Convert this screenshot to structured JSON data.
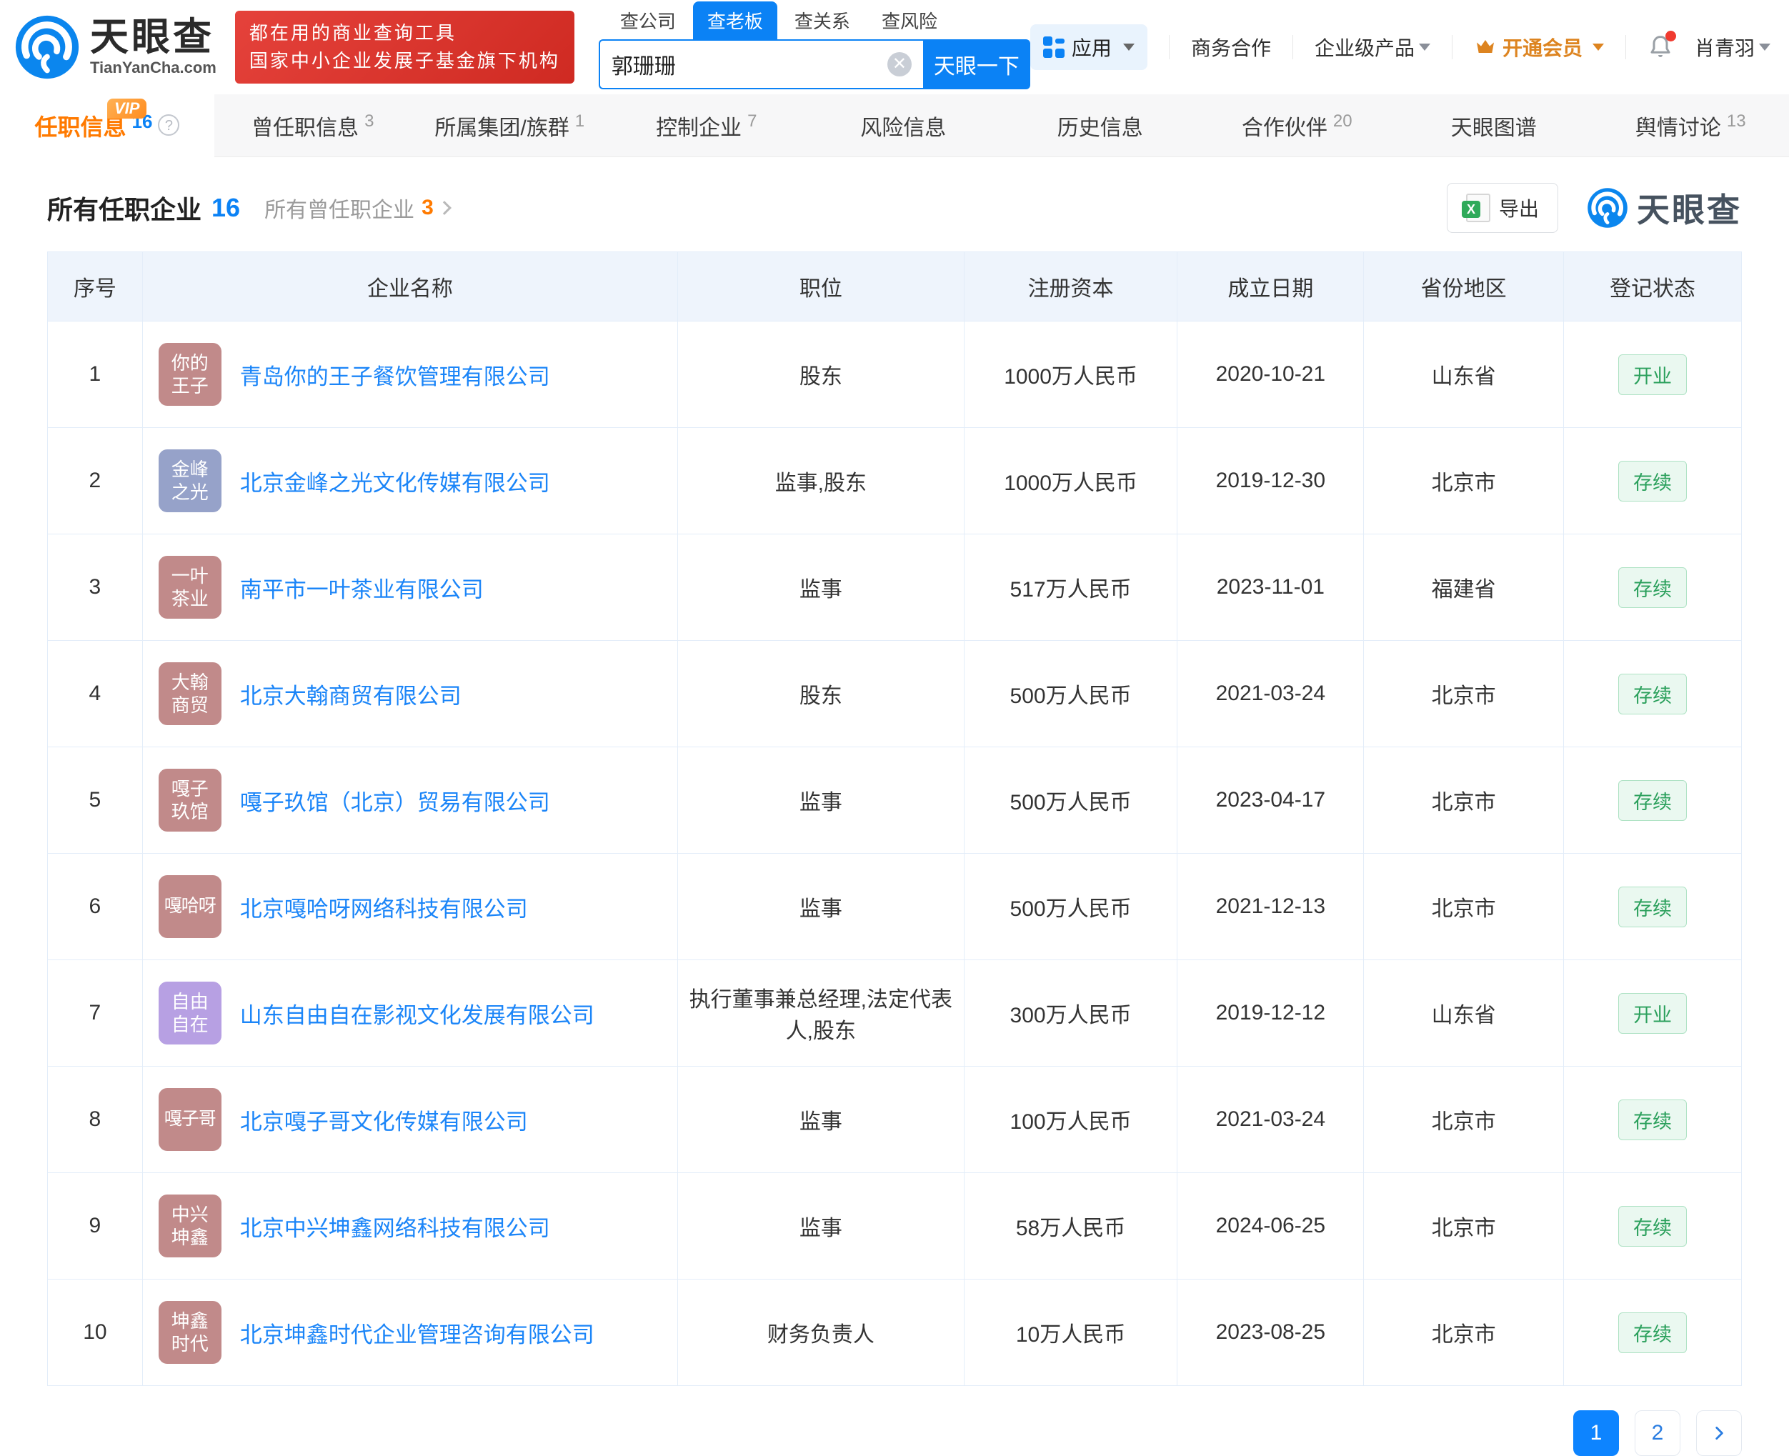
{
  "header": {
    "logo": {
      "title": "天眼查",
      "subtitle": "TianYanCha.com"
    },
    "promo": {
      "line1": "都在用的商业查询工具",
      "line2": "国家中小企业发展子基金旗下机构"
    },
    "search": {
      "tabs": [
        {
          "label": "查公司"
        },
        {
          "label": "查老板"
        },
        {
          "label": "查关系"
        },
        {
          "label": "查风险"
        }
      ],
      "value": "郭珊珊",
      "button": "天眼一下"
    },
    "menu": {
      "apps": "应用",
      "biz_coop": "商务合作",
      "enterprise": "企业级产品",
      "member": "开通会员",
      "user": "肖青羽"
    }
  },
  "nav_tabs": [
    {
      "label": "任职信息",
      "count": "16",
      "vip": "VIP"
    },
    {
      "label": "曾任职信息",
      "count": "3"
    },
    {
      "label": "所属集团/族群",
      "count": "1"
    },
    {
      "label": "控制企业",
      "count": "7"
    },
    {
      "label": "风险信息",
      "count": ""
    },
    {
      "label": "历史信息",
      "count": ""
    },
    {
      "label": "合作伙伴",
      "count": "20"
    },
    {
      "label": "天眼图谱",
      "count": ""
    },
    {
      "label": "舆情讨论",
      "count": "13"
    }
  ],
  "section": {
    "title": "所有任职企业",
    "count": "16",
    "sub_title": "所有曾任职企业",
    "sub_count": "3",
    "export_label": "导出",
    "watermark": "天眼查"
  },
  "table": {
    "columns": [
      "序号",
      "企业名称",
      "职位",
      "注册资本",
      "成立日期",
      "省份地区",
      "登记状态"
    ],
    "rows": [
      {
        "no": "1",
        "logo_text": "你的\n王子",
        "logo_color": "#c18a8a",
        "name": "青岛你的王子餐饮管理有限公司",
        "position": "股东",
        "capital": "1000万人民币",
        "date": "2020-10-21",
        "province": "山东省",
        "status": "开业"
      },
      {
        "no": "2",
        "logo_text": "金峰\n之光",
        "logo_color": "#96a2c9",
        "name": "北京金峰之光文化传媒有限公司",
        "position": "监事,股东",
        "capital": "1000万人民币",
        "date": "2019-12-30",
        "province": "北京市",
        "status": "存续"
      },
      {
        "no": "3",
        "logo_text": "一叶\n茶业",
        "logo_color": "#c18a8a",
        "name": "南平市一叶茶业有限公司",
        "position": "监事",
        "capital": "517万人民币",
        "date": "2023-11-01",
        "province": "福建省",
        "status": "存续"
      },
      {
        "no": "4",
        "logo_text": "大翰\n商贸",
        "logo_color": "#c18a8a",
        "name": "北京大翰商贸有限公司",
        "position": "股东",
        "capital": "500万人民币",
        "date": "2021-03-24",
        "province": "北京市",
        "status": "存续"
      },
      {
        "no": "5",
        "logo_text": "嘎子\n玖馆",
        "logo_color": "#c18a8a",
        "name": "嘎子玖馆（北京）贸易有限公司",
        "position": "监事",
        "capital": "500万人民币",
        "date": "2023-04-17",
        "province": "北京市",
        "status": "存续"
      },
      {
        "no": "6",
        "logo_text": "嘎哈呀",
        "logo_color": "#c18a8a",
        "name": "北京嘎哈呀网络科技有限公司",
        "position": "监事",
        "capital": "500万人民币",
        "date": "2021-12-13",
        "province": "北京市",
        "status": "存续"
      },
      {
        "no": "7",
        "logo_text": "自由\n自在",
        "logo_color": "#b7a0e3",
        "name": "山东自由自在影视文化发展有限公司",
        "position": "执行董事兼总经理,法定代表人,股东",
        "capital": "300万人民币",
        "date": "2019-12-12",
        "province": "山东省",
        "status": "开业"
      },
      {
        "no": "8",
        "logo_text": "嘎子哥",
        "logo_color": "#c18a8a",
        "name": "北京嘎子哥文化传媒有限公司",
        "position": "监事",
        "capital": "100万人民币",
        "date": "2021-03-24",
        "province": "北京市",
        "status": "存续"
      },
      {
        "no": "9",
        "logo_text": "中兴\n坤鑫",
        "logo_color": "#c18a8a",
        "name": "北京中兴坤鑫网络科技有限公司",
        "position": "监事",
        "capital": "58万人民币",
        "date": "2024-06-25",
        "province": "北京市",
        "status": "存续"
      },
      {
        "no": "10",
        "logo_text": "坤鑫\n时代",
        "logo_color": "#c18a8a",
        "name": "北京坤鑫时代企业管理咨询有限公司",
        "position": "财务负责人",
        "capital": "10万人民币",
        "date": "2023-08-25",
        "province": "北京市",
        "status": "存续"
      }
    ]
  },
  "pagination": {
    "page1": "1",
    "page2": "2"
  }
}
